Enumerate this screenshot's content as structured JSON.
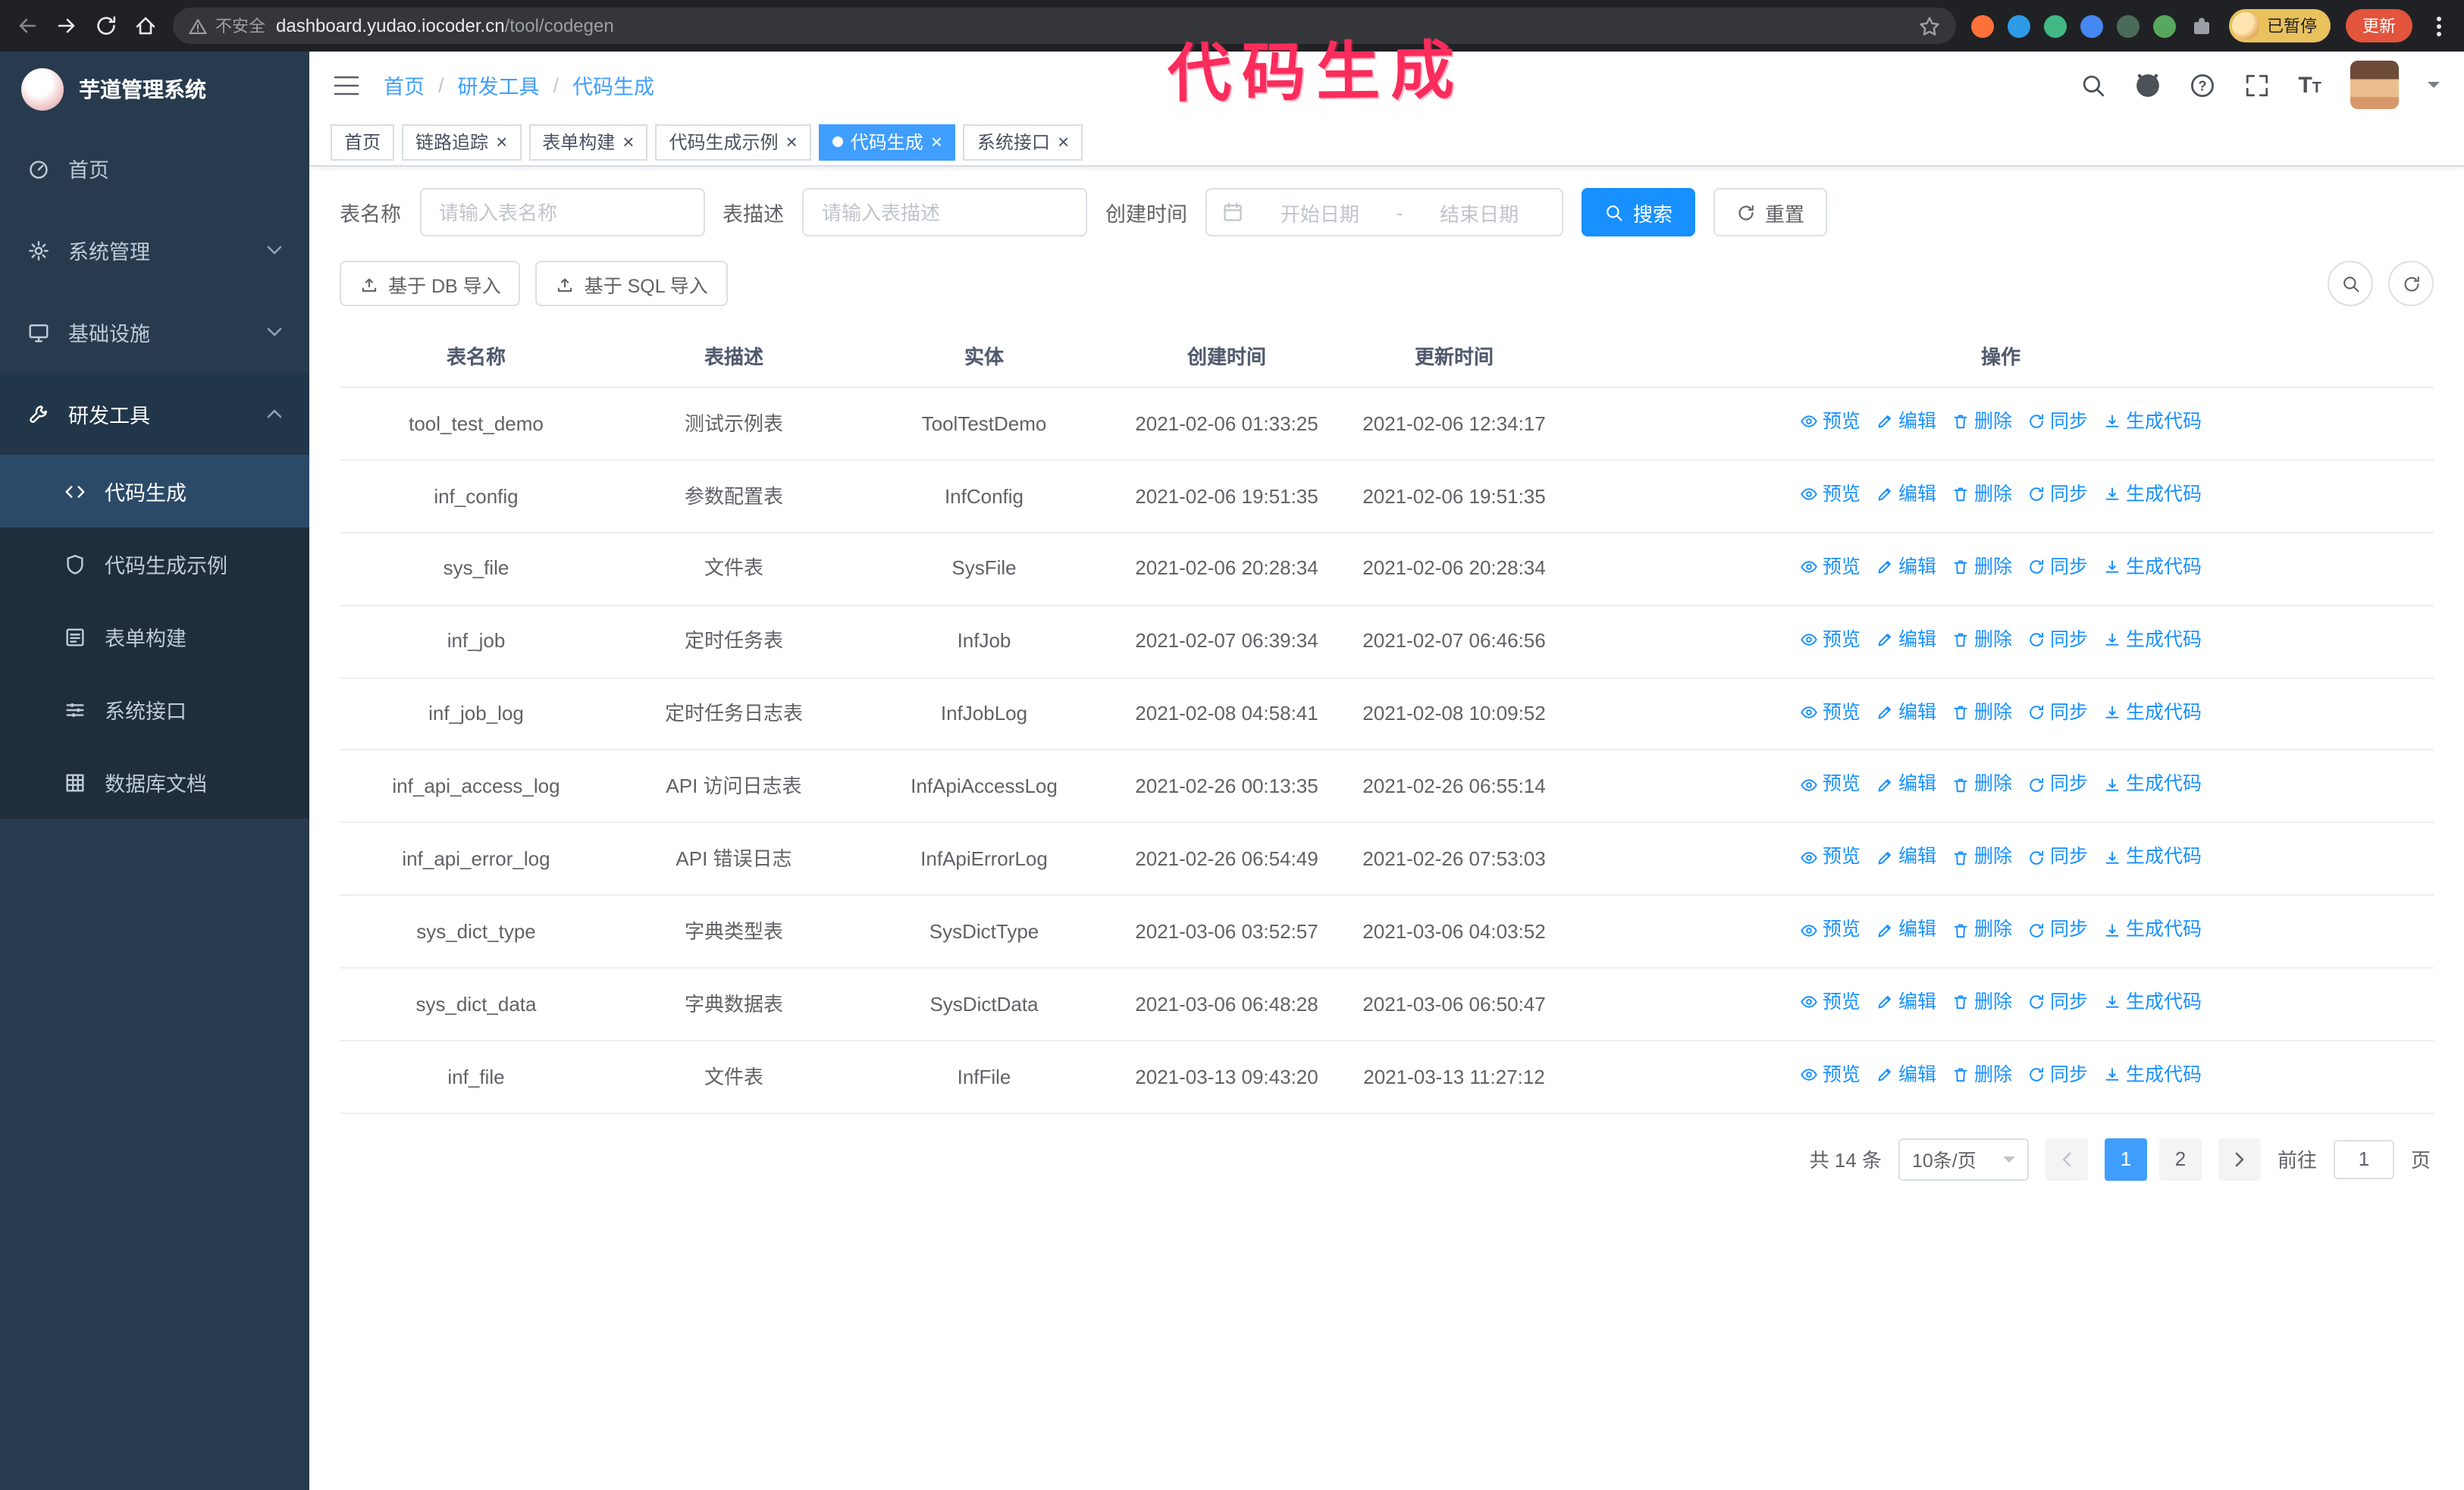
{
  "annotation": {
    "text": "代码生成",
    "color": "#fa2c5c"
  },
  "browser": {
    "security_label": "不安全",
    "url_host": "dashboard.yudao.iocoder.cn",
    "url_path": "/tool/codegen",
    "paused_badge": "已暂停",
    "update_button": "更新"
  },
  "sidebar": {
    "logo_title": "芋道管理系统",
    "items": [
      {
        "label": "首页"
      },
      {
        "label": "系统管理",
        "expandable": true
      },
      {
        "label": "基础设施",
        "expandable": true
      },
      {
        "label": "研发工具",
        "expandable": true,
        "expanded": true,
        "children": [
          {
            "label": "代码生成",
            "active": true
          },
          {
            "label": "代码生成示例"
          },
          {
            "label": "表单构建"
          },
          {
            "label": "系统接口"
          },
          {
            "label": "数据库文档"
          }
        ]
      }
    ]
  },
  "header": {
    "breadcrumb": [
      "首页",
      "研发工具",
      "代码生成"
    ]
  },
  "tabs": [
    {
      "label": "首页",
      "closable": false,
      "active": false
    },
    {
      "label": "链路追踪",
      "closable": true,
      "active": false
    },
    {
      "label": "表单构建",
      "closable": true,
      "active": false
    },
    {
      "label": "代码生成示例",
      "closable": true,
      "active": false
    },
    {
      "label": "代码生成",
      "closable": true,
      "active": true
    },
    {
      "label": "系统接口",
      "closable": true,
      "active": false
    }
  ],
  "filters": {
    "table_name_label": "表名称",
    "table_name_placeholder": "请输入表名称",
    "table_desc_label": "表描述",
    "table_desc_placeholder": "请输入表描述",
    "create_time_label": "创建时间",
    "date_start_placeholder": "开始日期",
    "date_separator": "-",
    "date_end_placeholder": "结束日期",
    "search_button": "搜索",
    "reset_button": "重置"
  },
  "toolbar": {
    "import_db_button": "基于 DB 导入",
    "import_sql_button": "基于 SQL 导入"
  },
  "table": {
    "columns": [
      "表名称",
      "表描述",
      "实体",
      "创建时间",
      "更新时间",
      "操作"
    ],
    "row_actions": [
      "预览",
      "编辑",
      "删除",
      "同步",
      "生成代码"
    ],
    "rows": [
      {
        "name": "tool_test_demo",
        "desc": "测试示例表",
        "entity": "ToolTestDemo",
        "create_time": "2021-02-06 01:33:25",
        "update_time": "2021-02-06 12:34:17"
      },
      {
        "name": "inf_config",
        "desc": "参数配置表",
        "entity": "InfConfig",
        "create_time": "2021-02-06 19:51:35",
        "update_time": "2021-02-06 19:51:35"
      },
      {
        "name": "sys_file",
        "desc": "文件表",
        "entity": "SysFile",
        "create_time": "2021-02-06 20:28:34",
        "update_time": "2021-02-06 20:28:34"
      },
      {
        "name": "inf_job",
        "desc": "定时任务表",
        "entity": "InfJob",
        "create_time": "2021-02-07 06:39:34",
        "update_time": "2021-02-07 06:46:56"
      },
      {
        "name": "inf_job_log",
        "desc": "定时任务日志表",
        "entity": "InfJobLog",
        "create_time": "2021-02-08 04:58:41",
        "update_time": "2021-02-08 10:09:52"
      },
      {
        "name": "inf_api_access_log",
        "desc": "API 访问日志表",
        "entity": "InfApiAccessLog",
        "create_time": "2021-02-26 00:13:35",
        "update_time": "2021-02-26 06:55:14"
      },
      {
        "name": "inf_api_error_log",
        "desc": "API 错误日志",
        "entity": "InfApiErrorLog",
        "create_time": "2021-02-26 06:54:49",
        "update_time": "2021-02-26 07:53:03"
      },
      {
        "name": "sys_dict_type",
        "desc": "字典类型表",
        "entity": "SysDictType",
        "create_time": "2021-03-06 03:52:57",
        "update_time": "2021-03-06 04:03:52"
      },
      {
        "name": "sys_dict_data",
        "desc": "字典数据表",
        "entity": "SysDictData",
        "create_time": "2021-03-06 06:48:28",
        "update_time": "2021-03-06 06:50:47"
      },
      {
        "name": "inf_file",
        "desc": "文件表",
        "entity": "InfFile",
        "create_time": "2021-03-13 09:43:20",
        "update_time": "2021-03-13 11:27:12"
      }
    ]
  },
  "pagination": {
    "total_text": "共 14 条",
    "page_size": "10条/页",
    "pages": [
      "1",
      "2"
    ],
    "active_page": "1",
    "goto_label": "前往",
    "goto_value": "1",
    "goto_suffix": "页"
  },
  "colors": {
    "primary": "#1890ff",
    "tag_active": "#409eff",
    "annotation": "#fa2c5c",
    "sidebar_bg": "#283b4e"
  }
}
